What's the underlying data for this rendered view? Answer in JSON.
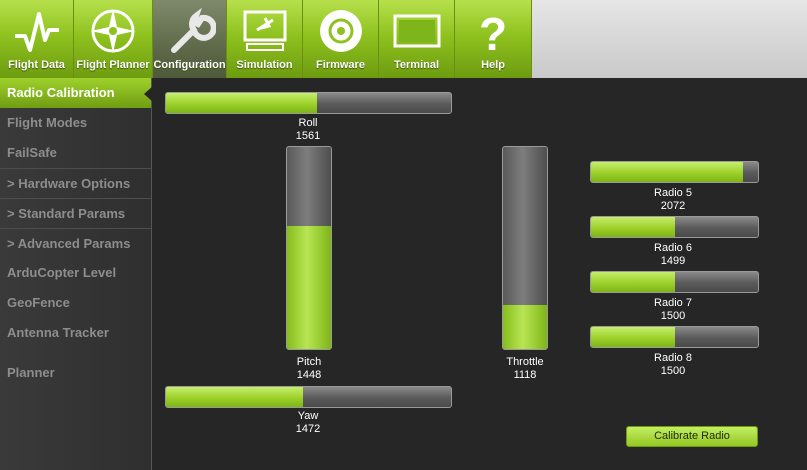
{
  "toolbar": {
    "items": [
      {
        "label": "Flight Data",
        "icon": "pulse-icon",
        "active": false
      },
      {
        "label": "Flight Planner",
        "icon": "compass-icon",
        "active": false
      },
      {
        "label": "Configuration",
        "icon": "wrench-icon",
        "active": true
      },
      {
        "label": "Simulation",
        "icon": "monitor-plane-icon",
        "active": false
      },
      {
        "label": "Firmware",
        "icon": "disc-icon",
        "active": false
      },
      {
        "label": "Terminal",
        "icon": "terminal-icon",
        "active": false
      },
      {
        "label": "Help",
        "icon": "question-icon",
        "active": false
      }
    ]
  },
  "sidebar": {
    "items": [
      {
        "label": "Radio Calibration",
        "active": true
      },
      {
        "label": "Flight Modes"
      },
      {
        "label": "FailSafe"
      },
      {
        "label": "> Hardware Options"
      },
      {
        "label": "> Standard Params"
      },
      {
        "label": "> Advanced Params"
      },
      {
        "label": "ArduCopter Level"
      },
      {
        "label": "GeoFence"
      },
      {
        "label": "Antenna Tracker"
      },
      {
        "label": "Planner"
      }
    ]
  },
  "radio": {
    "range": [
      1000,
      2100
    ],
    "roll": {
      "label": "Roll",
      "value": "1561",
      "fill": 0.53
    },
    "pitch": {
      "label": "Pitch",
      "value": "1448",
      "fill": 0.61
    },
    "throttle": {
      "label": "Throttle",
      "value": "1118",
      "fill": 0.22
    },
    "yaw": {
      "label": "Yaw",
      "value": "1472",
      "fill": 0.48
    },
    "radio5": {
      "label": "Radio 5",
      "value": "2072",
      "fill": 0.91
    },
    "radio6": {
      "label": "Radio 6",
      "value": "1499",
      "fill": 0.5
    },
    "radio7": {
      "label": "Radio 7",
      "value": "1500",
      "fill": 0.5
    },
    "radio8": {
      "label": "Radio 8",
      "value": "1500",
      "fill": 0.5
    }
  },
  "calibrate_label": "Calibrate Radio",
  "colors": {
    "accent": "#8fc21f",
    "bar_fill": "#9cd02a",
    "bar_track": "#5a5a5a",
    "background": "#262626"
  }
}
